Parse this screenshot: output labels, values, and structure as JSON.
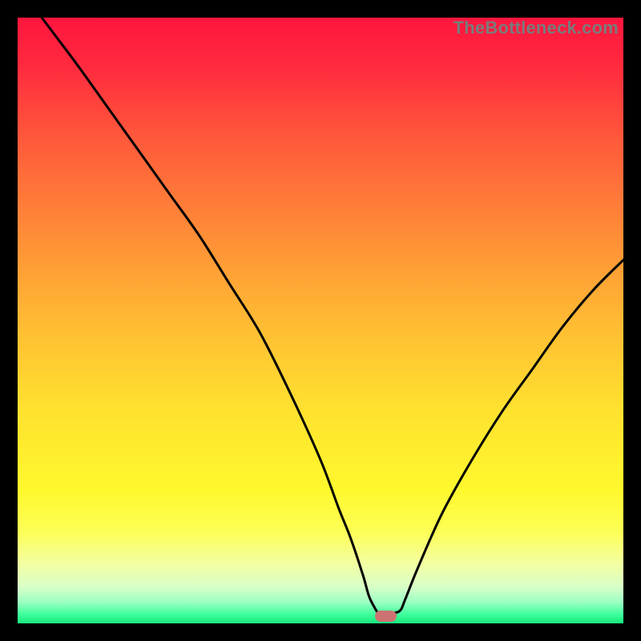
{
  "watermark": "TheBottleneck.com",
  "colors": {
    "frame": "#000000",
    "gradient_stops": [
      {
        "offset": 0.0,
        "color": "#ff153e"
      },
      {
        "offset": 0.08,
        "color": "#ff2a3e"
      },
      {
        "offset": 0.2,
        "color": "#ff593b"
      },
      {
        "offset": 0.35,
        "color": "#ff8a37"
      },
      {
        "offset": 0.5,
        "color": "#ffba33"
      },
      {
        "offset": 0.65,
        "color": "#ffe22f"
      },
      {
        "offset": 0.78,
        "color": "#fff82d"
      },
      {
        "offset": 0.85,
        "color": "#fdff57"
      },
      {
        "offset": 0.9,
        "color": "#f4ffa0"
      },
      {
        "offset": 0.94,
        "color": "#d8ffc8"
      },
      {
        "offset": 0.965,
        "color": "#9cffc3"
      },
      {
        "offset": 0.985,
        "color": "#3eff9c"
      },
      {
        "offset": 1.0,
        "color": "#17e77a"
      }
    ],
    "curve": "#000000",
    "marker": "#cd7273"
  },
  "chart_data": {
    "type": "line",
    "title": "",
    "xlabel": "",
    "ylabel": "",
    "xlim": [
      0,
      100
    ],
    "ylim": [
      0,
      100
    ],
    "series": [
      {
        "name": "bottleneck",
        "x": [
          4,
          7,
          10,
          15,
          20,
          25,
          30,
          35,
          40,
          45,
          50,
          53,
          55,
          57,
          58,
          59,
          59.6,
          61,
          63,
          64,
          66,
          70,
          75,
          80,
          85,
          90,
          95,
          100
        ],
        "values": [
          100,
          96,
          92,
          85,
          78,
          71,
          64,
          56,
          48,
          38,
          27,
          19,
          14,
          8,
          4.5,
          2.5,
          1.7,
          1.7,
          2.0,
          4,
          9,
          18,
          27,
          35,
          42,
          49,
          55,
          60
        ]
      }
    ],
    "notch": {
      "x_start": 59.0,
      "x_end": 62.6,
      "y": 1.2
    },
    "annotations": []
  }
}
